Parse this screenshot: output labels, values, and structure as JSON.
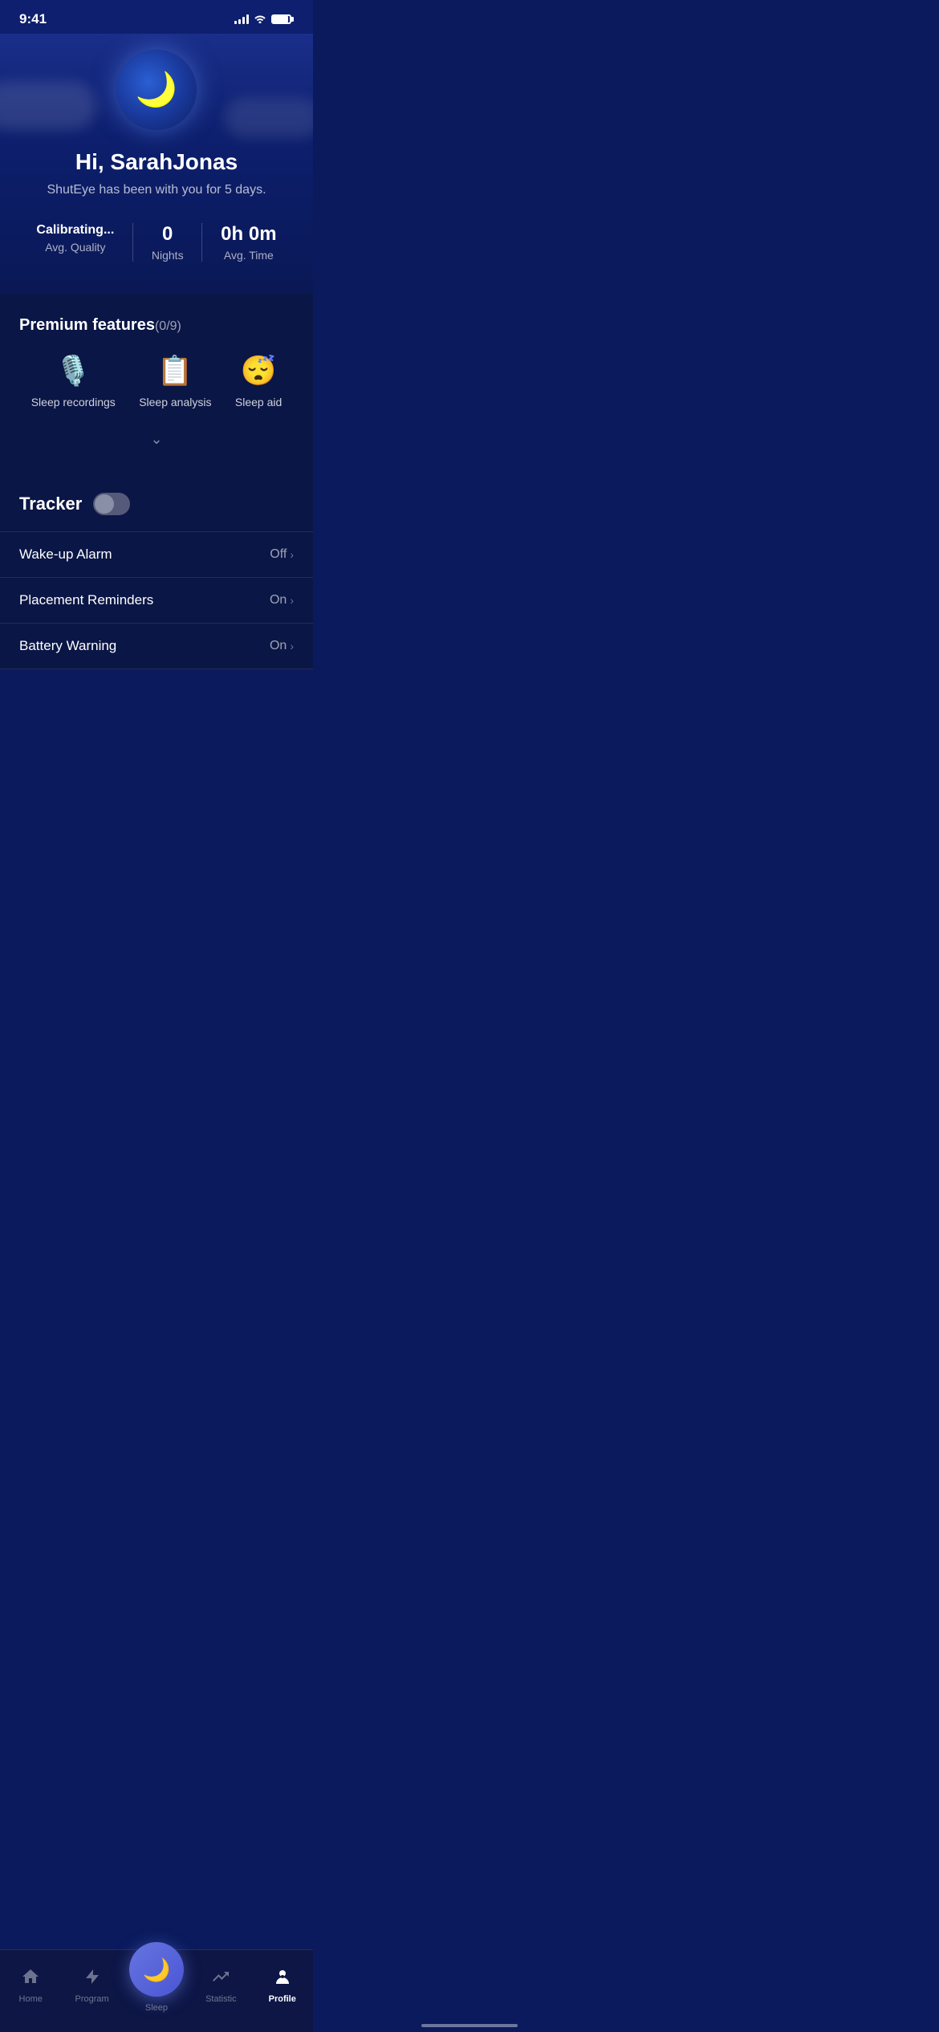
{
  "statusBar": {
    "time": "9:41"
  },
  "hero": {
    "greeting": "Hi, SarahJonas",
    "subtitle": "ShutEye has been with you for 5 days."
  },
  "stats": {
    "avgQuality": {
      "value": "Calibrating...",
      "label": "Avg. Quality"
    },
    "nights": {
      "value": "0",
      "label": "Nights"
    },
    "avgTime": {
      "value": "0h 0m",
      "label": "Avg. Time"
    }
  },
  "premiumFeatures": {
    "title": "Premium features",
    "count": "(0/9)",
    "features": [
      {
        "label": "Sleep recordings",
        "icon": "🎙️"
      },
      {
        "label": "Sleep analysis",
        "icon": "📋"
      },
      {
        "label": "Sleep aid",
        "icon": "😴"
      }
    ]
  },
  "tracker": {
    "title": "Tracker",
    "toggleState": "off"
  },
  "settings": [
    {
      "label": "Wake-up Alarm",
      "value": "Off"
    },
    {
      "label": "Placement Reminders",
      "value": "On"
    },
    {
      "label": "Battery Warning",
      "value": "On"
    }
  ],
  "bottomNav": {
    "items": [
      {
        "label": "Home",
        "icon": "🏠",
        "active": false
      },
      {
        "label": "Program",
        "icon": "⚡",
        "active": false
      },
      {
        "label": "Sleep",
        "icon": "🌙",
        "active": false,
        "isSleep": true
      },
      {
        "label": "Statistic",
        "icon": "📈",
        "active": false
      },
      {
        "label": "Profile",
        "icon": "👤",
        "active": true
      }
    ]
  }
}
